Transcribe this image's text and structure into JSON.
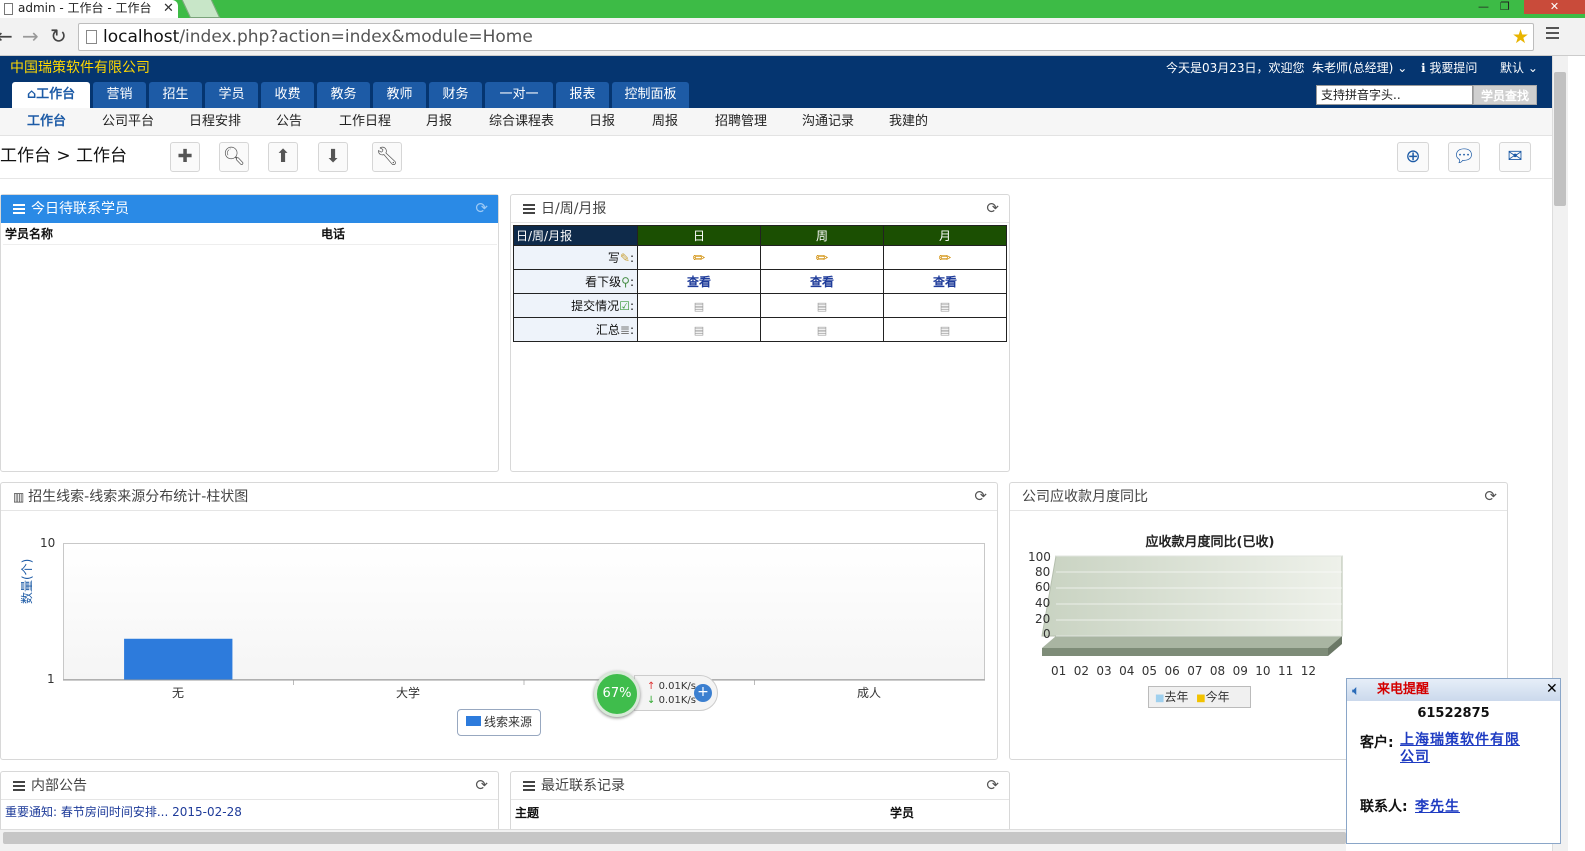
{
  "browser": {
    "tab_title": "admin - 工作台 - 工作台",
    "url_host": "localhost",
    "url_path": "/index.php?action=index&module=Home"
  },
  "header": {
    "company": "中国瑞策软件有限公司",
    "date_greeting": "今天是03月23日，欢迎您",
    "user": "朱老师(总经理)",
    "help": "我要提问",
    "theme": "默认",
    "search_placeholder": "支持拼音字头..",
    "search_button": "学员查找"
  },
  "main_tabs": [
    "工作台",
    "营销",
    "招生",
    "学员",
    "收费",
    "教务",
    "教师",
    "财务",
    "一对一",
    "报表",
    "控制面板"
  ],
  "sub_tabs": [
    "工作台",
    "公司平台",
    "日程安排",
    "公告",
    "工作日程",
    "月报",
    "综合课程表",
    "日报",
    "周报",
    "招聘管理",
    "沟通记录",
    "我建的"
  ],
  "breadcrumb": "工作台 > 工作台",
  "panels": {
    "today_contacts": {
      "title": "今日待联系学员",
      "col_name": "学员名称",
      "col_phone": "电话"
    },
    "reports": {
      "title": "日/周/月报",
      "corner": "日/周/月报",
      "cols": [
        "日",
        "周",
        "月"
      ],
      "rows": [
        {
          "label": "写",
          "type": "write"
        },
        {
          "label": "看下级",
          "type": "view",
          "link": "查看"
        },
        {
          "label": "提交情况",
          "type": "doc"
        },
        {
          "label": "汇总",
          "type": "doc"
        }
      ]
    },
    "leads_chart": {
      "title": "招生线索-线索来源分布统计-柱状图"
    },
    "receivables": {
      "title": "公司应收款月度同比"
    },
    "notices": {
      "title": "内部公告",
      "items": [
        {
          "text": "重要通知: 春节房间时间安排...",
          "date": "2015-02-28"
        }
      ]
    },
    "recent_contacts": {
      "title": "最近联系记录",
      "col_subject": "主题",
      "col_student": "学员"
    }
  },
  "chart_data": [
    {
      "type": "bar",
      "title": "",
      "ylabel": "数量(个)",
      "xlabel": "",
      "categories": [
        "无",
        "大学",
        "",
        "成人"
      ],
      "series": [
        {
          "name": "线索来源",
          "values": [
            2,
            0,
            0,
            0
          ],
          "color": "#2d7bdc"
        }
      ],
      "yticks": [
        "10",
        "1"
      ],
      "ylim": [
        1,
        10
      ],
      "grid": false,
      "legend": "bottom-center"
    },
    {
      "type": "bar",
      "title": "应收款月度同比(已收)",
      "categories": [
        "01",
        "02",
        "03",
        "04",
        "05",
        "06",
        "07",
        "08",
        "09",
        "10",
        "11",
        "12"
      ],
      "series": [
        {
          "name": "去年",
          "values": [
            0,
            0,
            0,
            0,
            0,
            0,
            0,
            0,
            0,
            0,
            0,
            0
          ],
          "color": "#9fd0ee"
        },
        {
          "name": "今年",
          "values": [
            0,
            0,
            0,
            0,
            0,
            0,
            0,
            0,
            0,
            0,
            0,
            0
          ],
          "color": "#f2c200"
        }
      ],
      "yticks": [
        "100",
        "80",
        "60",
        "40",
        "20",
        "0"
      ],
      "ylim": [
        0,
        100
      ],
      "grid": true,
      "legend": "bottom-center"
    }
  ],
  "network_widget": {
    "percent": "67%",
    "up": "0.01K/s",
    "down": "0.01K/s"
  },
  "call_popup": {
    "title": "来电提醒",
    "phone": "61522875",
    "customer_label": "客户:",
    "customer_line1": "上海瑞策软件有限",
    "customer_line2": "公司",
    "contact_label": "联系人:",
    "contact_name": "李先生"
  }
}
